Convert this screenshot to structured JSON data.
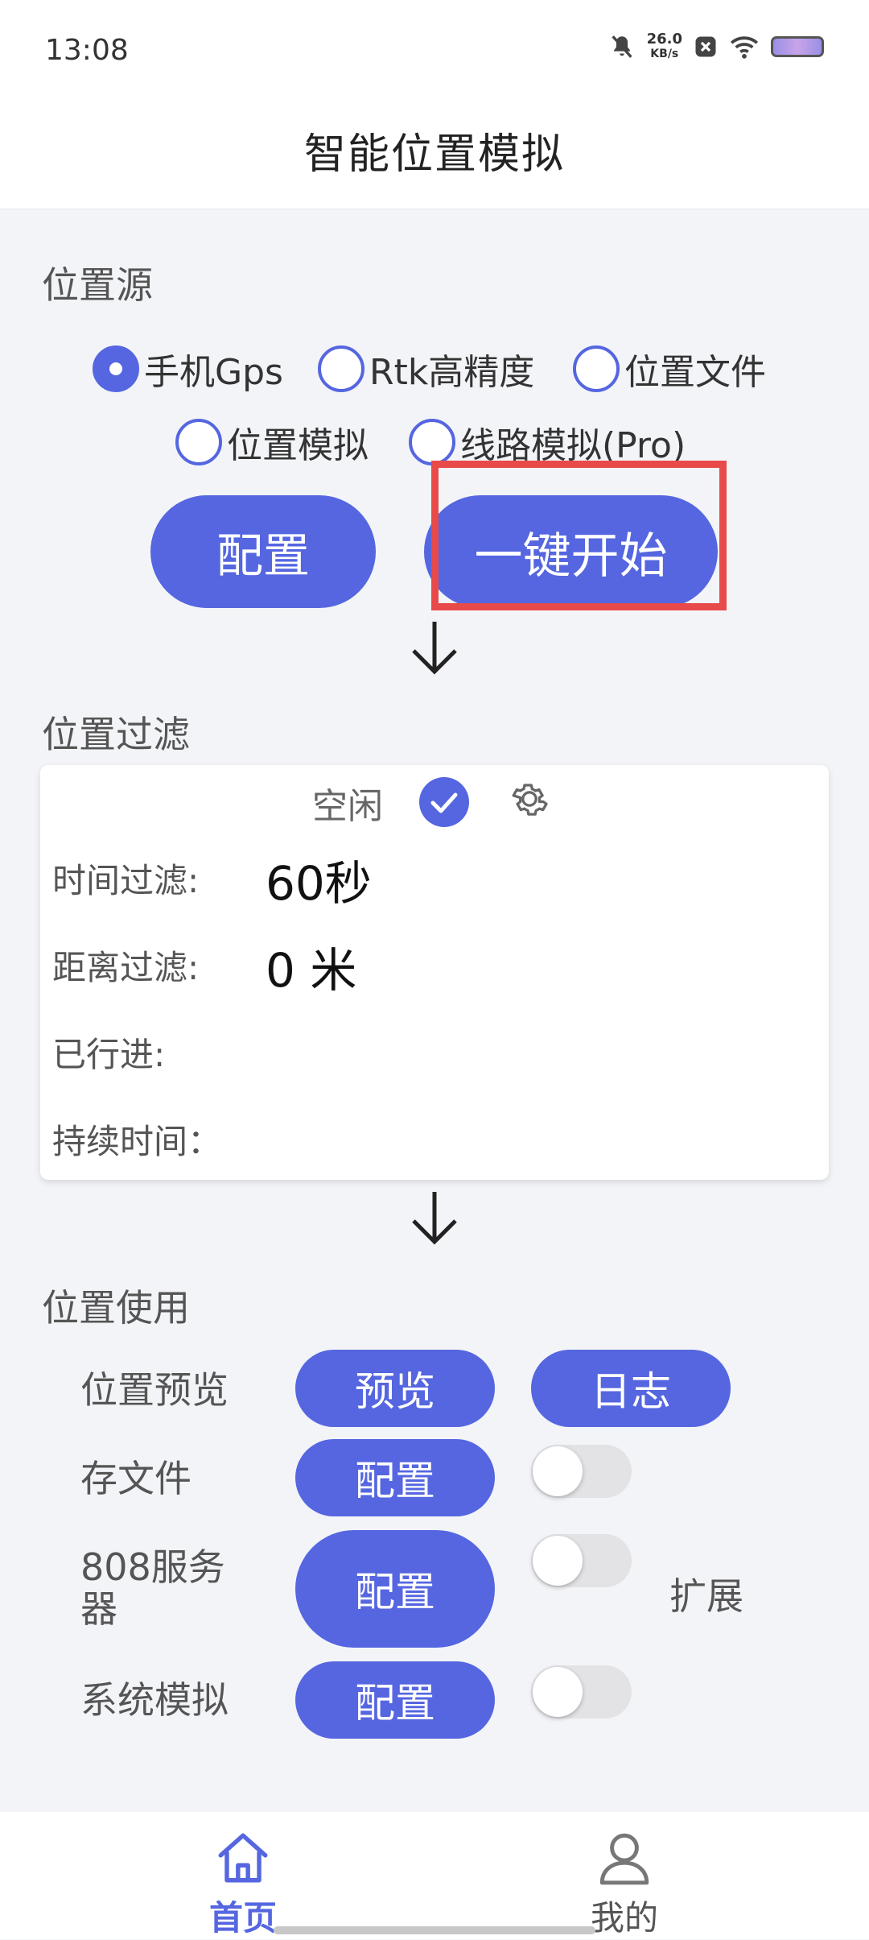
{
  "status_bar": {
    "time": "13:08",
    "net_speed_value": "26.0",
    "net_speed_unit": "KB/s",
    "icons": [
      "mute-bell-icon",
      "notification-x-icon",
      "wifi-icon",
      "battery-icon"
    ]
  },
  "header": {
    "title": "智能位置模拟"
  },
  "source": {
    "title": "位置源",
    "options": [
      {
        "label": "手机Gps",
        "selected": true
      },
      {
        "label": "Rtk高精度",
        "selected": false
      },
      {
        "label": "位置文件",
        "selected": false
      },
      {
        "label": "位置模拟",
        "selected": false
      },
      {
        "label": "线路模拟(Pro)",
        "selected": false
      }
    ],
    "config_button": "配置",
    "start_button": "一键开始"
  },
  "filter": {
    "title": "位置过滤",
    "status_text": "空闲",
    "rows": [
      {
        "label": "时间过滤:",
        "value": "60秒"
      },
      {
        "label": "距离过滤:",
        "value": "0 米"
      },
      {
        "label": "已行进:",
        "value": ""
      },
      {
        "label": "持续时间：",
        "value": ""
      }
    ]
  },
  "usage": {
    "title": "位置使用",
    "preview_label": "位置预览",
    "preview_button": "预览",
    "log_button": "日志",
    "file_label": "存文件",
    "file_button": "配置",
    "server_label": "808服务器",
    "server_button": "配置",
    "extend_label": "扩展",
    "system_label": "系统模拟",
    "system_button": "配置"
  },
  "nav": {
    "items": [
      {
        "label": "首页",
        "active": true
      },
      {
        "label": "我的",
        "active": false
      }
    ]
  },
  "colors": {
    "accent": "#5566e0",
    "highlight_box": "#e84a4a",
    "background": "#f3f4f8"
  }
}
